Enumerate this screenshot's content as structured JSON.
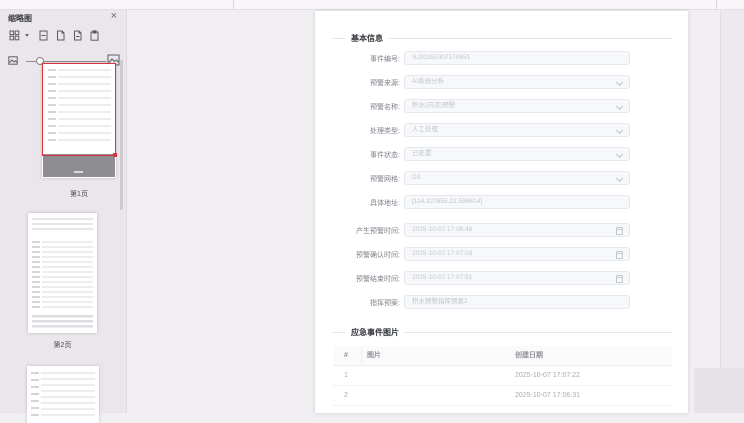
{
  "panel": {
    "title": "缩略图",
    "close_label": "×",
    "toolbar_icons": [
      "view-mode-icon",
      "remove-page-icon",
      "copy-page-icon",
      "extract-page-icon",
      "paste-page-icon"
    ],
    "size_slider": {
      "left_icon": "small-thumbnail-icon",
      "right_icon": "large-thumbnail-icon",
      "value_percent": 17
    }
  },
  "thumbnails": [
    {
      "label": "第1页",
      "selected": true
    },
    {
      "label": "第2页",
      "selected": false
    },
    {
      "label": "",
      "selected": false
    }
  ],
  "document": {
    "basic_info": {
      "title": "基本信息",
      "fields": [
        {
          "label": "事件编号:",
          "value": "SJ20251007170651",
          "control": "input"
        },
        {
          "label": "预警来源:",
          "value": "AI系统分析",
          "control": "select"
        },
        {
          "label": "预警名称:",
          "value": "积水(内涝)预警",
          "control": "select"
        },
        {
          "label": "处理类型:",
          "value": "人工处理",
          "control": "select"
        },
        {
          "label": "事件状态:",
          "value": "已处置",
          "control": "select"
        },
        {
          "label": "预警网格:",
          "value": "D3",
          "control": "select"
        },
        {
          "label": "具体地址:",
          "value": "[114.327855,22.596614]",
          "control": "input"
        },
        {
          "label": "产生预警时间:",
          "value": "2025-10-07 17:06:46",
          "control": "date"
        },
        {
          "label": "预警确认时间:",
          "value": "2025-10-07 17:07:03",
          "control": "date"
        },
        {
          "label": "预警结束时间:",
          "value": "2025-10-07 17:07:51",
          "control": "date"
        },
        {
          "label": "指挥预案:",
          "value": "积水预警指挥预案2",
          "control": "input"
        }
      ]
    },
    "event_images": {
      "title": "应急事件图片",
      "table": {
        "headers": [
          "#",
          "图片",
          "创建日期"
        ],
        "rows": [
          {
            "index": "1",
            "image": "",
            "created": "2025-10-07 17:07:22"
          },
          {
            "index": "2",
            "image": "",
            "created": "2025-10-07 17:06:31"
          }
        ]
      }
    }
  },
  "colors": {
    "selection_red": "#d9343e",
    "disabled_text": "#c0c4cc",
    "divider": "#e4e7ed"
  }
}
